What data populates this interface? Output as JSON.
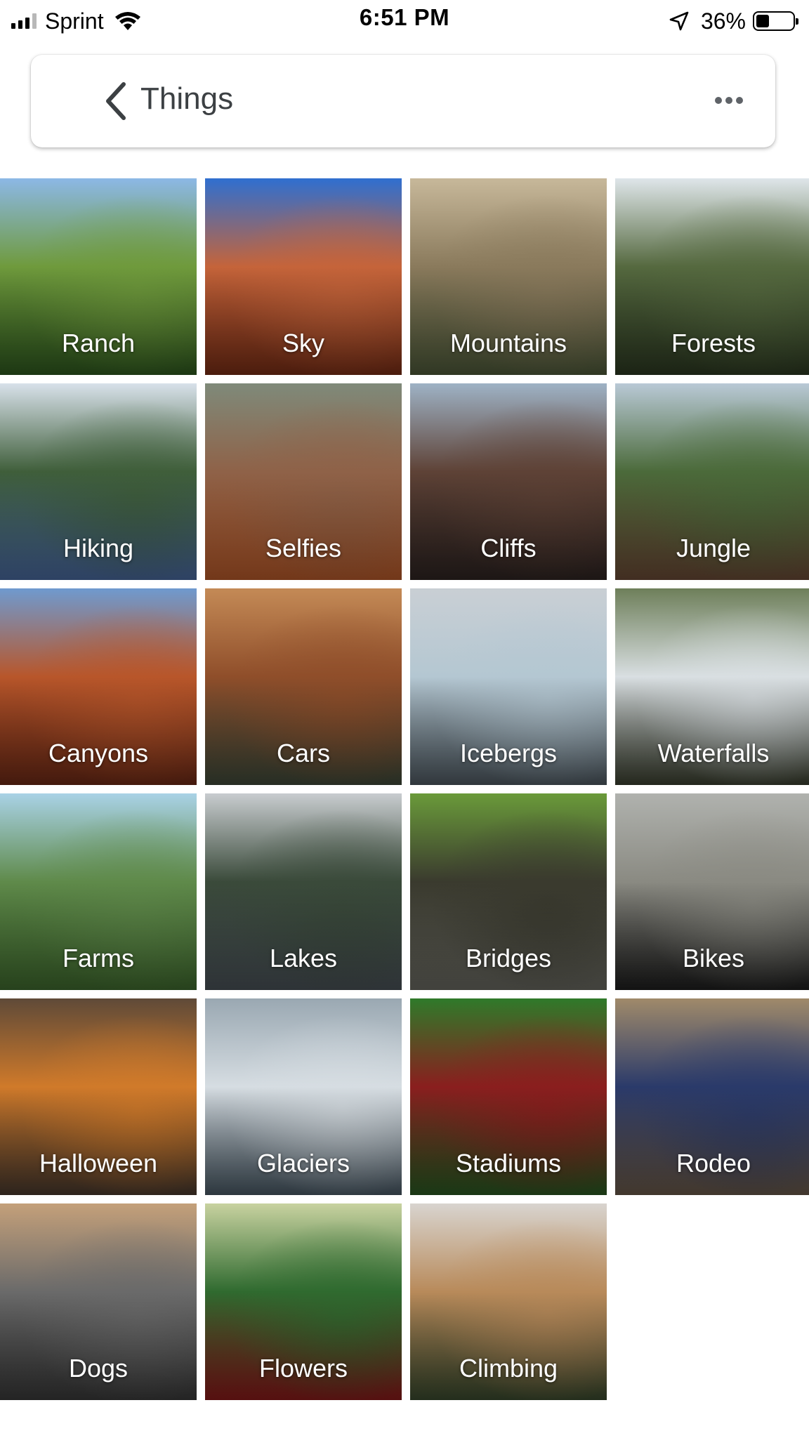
{
  "status_bar": {
    "carrier": "Sprint",
    "time": "6:51 PM",
    "battery_percent": "36%",
    "battery_level": 0.36,
    "signal_bars": 3,
    "signal_bars_total": 4,
    "icons": [
      "signal-icon",
      "wifi-icon",
      "location-arrow-icon",
      "battery-icon"
    ]
  },
  "header": {
    "title": "Things",
    "back_icon": "chevron-left-icon",
    "more_icon": "more-horizontal-icon"
  },
  "categories": [
    {
      "label": "Ranch",
      "colors": [
        "#8cb8e6",
        "#6f9a3c",
        "#2f5a1f"
      ]
    },
    {
      "label": "Sky",
      "colors": [
        "#2f6fd0",
        "#c5643a",
        "#7a2e16"
      ]
    },
    {
      "label": "Mountains",
      "colors": [
        "#c7b89a",
        "#8a7a5c",
        "#4e5a3a"
      ]
    },
    {
      "label": "Forests",
      "colors": [
        "#dfe6ea",
        "#55693f",
        "#2d3a22"
      ]
    },
    {
      "label": "Hiking",
      "colors": [
        "#d8e1ea",
        "#3f5e3a",
        "#4a6aa0"
      ]
    },
    {
      "label": "Selfies",
      "colors": [
        "#7f8a7a",
        "#8f6248",
        "#b85a2a"
      ]
    },
    {
      "label": "Cliffs",
      "colors": [
        "#9eb2c5",
        "#5e4236",
        "#2e2422"
      ]
    },
    {
      "label": "Jungle",
      "colors": [
        "#b9c9d6",
        "#4b6a3a",
        "#6a4a36"
      ]
    },
    {
      "label": "Canyons",
      "colors": [
        "#6f9acf",
        "#b8562a",
        "#6e2a16"
      ]
    },
    {
      "label": "Cars",
      "colors": [
        "#c48a56",
        "#8f4e2a",
        "#3f4a3a"
      ]
    },
    {
      "label": "Icebergs",
      "colors": [
        "#c9cfd4",
        "#b4c7d2",
        "#4f5a62"
      ]
    },
    {
      "label": "Waterfalls",
      "colors": [
        "#6e7f5a",
        "#d9dfe2",
        "#3b4030"
      ]
    },
    {
      "label": "Farms",
      "colors": [
        "#a9d2e6",
        "#5f8a4a",
        "#3f6a2e"
      ]
    },
    {
      "label": "Lakes",
      "colors": [
        "#c8cccf",
        "#3a4a3a",
        "#4a5258"
      ]
    },
    {
      "label": "Bridges",
      "colors": [
        "#6a9a3a",
        "#3a3a2e",
        "#6a6a62"
      ]
    },
    {
      "label": "Bikes",
      "colors": [
        "#b0b2ae",
        "#8a8a82",
        "#1e1e1e"
      ]
    },
    {
      "label": "Halloween",
      "colors": [
        "#5f4a38",
        "#d07a2a",
        "#4a3a2e"
      ]
    },
    {
      "label": "Glaciers",
      "colors": [
        "#9aa8b2",
        "#d6dde2",
        "#4a5a66"
      ]
    },
    {
      "label": "Stadiums",
      "colors": [
        "#2f7a2a",
        "#8a1e1e",
        "#2a5a22"
      ]
    },
    {
      "label": "Rodeo",
      "colors": [
        "#a08a6a",
        "#2a3a6a",
        "#6a5a4a"
      ]
    },
    {
      "label": "Dogs",
      "colors": [
        "#c4a07a",
        "#6a6a6a",
        "#3a3a3a"
      ]
    },
    {
      "label": "Flowers",
      "colors": [
        "#c8d2a0",
        "#2f6a2f",
        "#8a1a1a"
      ]
    },
    {
      "label": "Climbing",
      "colors": [
        "#d8d4cf",
        "#b88a5a",
        "#3a4a2e"
      ]
    }
  ]
}
